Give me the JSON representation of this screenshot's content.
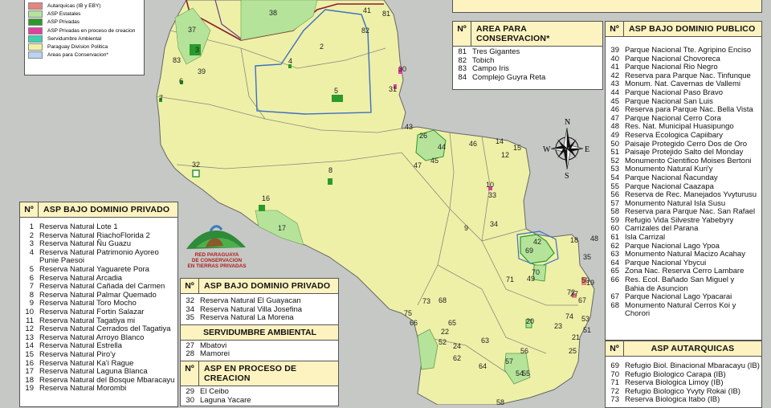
{
  "legend": [
    {
      "label": "Autarquicas (IB y EBY)",
      "color": "#e8837f"
    },
    {
      "label": "ASP Estatales",
      "color": "#b5e39a"
    },
    {
      "label": "ASP Privadas",
      "color": "#2a9a2a"
    },
    {
      "label": "ASP Privadas en proceso de creacion",
      "color": "#e040a0"
    },
    {
      "label": "Servidumbre Ambiental",
      "color": "#40d0b0"
    },
    {
      "label": "Paraguay Division Politica",
      "color": "#eef0a8"
    },
    {
      "label": "Areas para Conservacion*",
      "color": "#b8d4f0"
    }
  ],
  "map_labels": [
    "38",
    "41",
    "81",
    "82",
    "37",
    "2",
    "3",
    "83",
    "4",
    "39",
    "30",
    "6",
    "5",
    "31",
    "7",
    "43",
    "26",
    "44",
    "46",
    "14",
    "15",
    "45",
    "12",
    "47",
    "32",
    "8",
    "10",
    "33",
    "16",
    "9",
    "34",
    "17",
    "42",
    "18",
    "48",
    "69",
    "35",
    "70",
    "19",
    "71",
    "49",
    "50",
    "72",
    "73",
    "67",
    "75",
    "68",
    "66",
    "65",
    "27",
    "74",
    "20",
    "23",
    "53",
    "51",
    "21",
    "22",
    "52",
    "25",
    "63",
    "24",
    "62",
    "64",
    "57",
    "56",
    "55",
    "54",
    "58"
  ],
  "logo": {
    "line1": "RED PARAGUAYA",
    "line2": "DE CONSERVACION",
    "line3": "EN TIERRAS PRIVADAS"
  },
  "compass": {
    "n": "N",
    "s": "S",
    "e": "E",
    "w": "W"
  },
  "conservacion": {
    "num_header": "Nº",
    "title": "AREA PARA CONSERVACION*",
    "rows": [
      {
        "n": "81",
        "t": "Tres Gigantes"
      },
      {
        "n": "82",
        "t": "Tobich"
      },
      {
        "n": "83",
        "t": "Campo Iris"
      },
      {
        "n": "84",
        "t": "Complejo Guyra Reta"
      }
    ]
  },
  "publico": {
    "num_header": "Nº",
    "title": "ASP BAJO DOMINIO PUBLICO",
    "rows": [
      {
        "n": "39",
        "t": "Parque Nacional Tte. Agripino Enciso"
      },
      {
        "n": "40",
        "t": "Parque Nacional Chovoreca"
      },
      {
        "n": "41",
        "t": "Parque Nacional Rio Negro"
      },
      {
        "n": "42",
        "t": "Reserva para Parque Nac. Tinfunque"
      },
      {
        "n": "43",
        "t": "Monum. Nat. Cavernas de Vallemi"
      },
      {
        "n": "44",
        "t": "Parque Nacional Paso Bravo"
      },
      {
        "n": "45",
        "t": "Parque Nacional San Luis"
      },
      {
        "n": "46",
        "t": "Reserva para Parque Nac. Bella Vista"
      },
      {
        "n": "47",
        "t": "Parque Nacional Cerro Cora"
      },
      {
        "n": "48",
        "t": "Res. Nat. Municipal Huasipungo"
      },
      {
        "n": "49",
        "t": "Reserva Ecologica Capiibary"
      },
      {
        "n": "50",
        "t": "Paisaje Protegido Cerro Dos de Oro"
      },
      {
        "n": "51",
        "t": "Paisaje Protejido Salto del Monday"
      },
      {
        "n": "52",
        "t": "Monumento Cientifico Moises Bertoni"
      },
      {
        "n": "53",
        "t": "Monumento Natural Kuri'y"
      },
      {
        "n": "54",
        "t": "Parque Nacional Ñacunday"
      },
      {
        "n": "55",
        "t": "Parque Nacional Caazapa"
      },
      {
        "n": "56",
        "t": "Reserva de Rec. Manejados Yvyturusu"
      },
      {
        "n": "57",
        "t": "Monumento Natural Isla Susu"
      },
      {
        "n": "58",
        "t": "Reserva para Parque Nac. San Rafael"
      },
      {
        "n": "59",
        "t": "Refugio Vida Silvestre Yabebyry"
      },
      {
        "n": "60",
        "t": "Carrizales del Parana"
      },
      {
        "n": "61",
        "t": "Isla Carrizal"
      },
      {
        "n": "62",
        "t": "Parque Nacional Lago Ypoa"
      },
      {
        "n": "63",
        "t": "Monumento Natural Macizo Acahay"
      },
      {
        "n": "64",
        "t": "Parque Nacional Ybycui"
      },
      {
        "n": "65",
        "t": "Zona Nac. Reserva Cerro Lambare"
      },
      {
        "n": "66",
        "t": "Res. Ecol. Bañado San Miguel y"
      },
      {
        "n": "",
        "t": "Bahia de Asuncion"
      },
      {
        "n": "67",
        "t": "Parque Nacional Lago Ypacarai"
      },
      {
        "n": "68",
        "t": "Monumento Natural Cerros Koi y"
      },
      {
        "n": "",
        "t": "Chorori"
      }
    ]
  },
  "autarquicas": {
    "num_header": "Nº",
    "title": "ASP AUTARQUICAS",
    "rows": [
      {
        "n": "69",
        "t": "Refugio Biol. Binacional Mbaracayu (IB)"
      },
      {
        "n": "70",
        "t": "Refugio Biologico Carapa (IB)"
      },
      {
        "n": "71",
        "t": "Reserva Biologica Limoy (IB)"
      },
      {
        "n": "72",
        "t": "Refugio Biologico Yvyty Rokai (IB)"
      },
      {
        "n": "73",
        "t": "Reserva Biologica Itabo (IB)"
      }
    ]
  },
  "privado1": {
    "num_header": "Nº",
    "title": "ASP BAJO DOMINIO PRIVADO",
    "rows": [
      {
        "n": "1",
        "t": "Reserva Natural Lote 1"
      },
      {
        "n": "2",
        "t": "Reserva Natural RiachoFlorida 2"
      },
      {
        "n": "3",
        "t": "Reserva Natural Ñu Guazu"
      },
      {
        "n": "4",
        "t": "Reserva Natural Patrimonio Ayoreo"
      },
      {
        "n": "",
        "t": "Punie Paesoi"
      },
      {
        "n": "5",
        "t": "Reserva Natural Yaguarete Pora"
      },
      {
        "n": "6",
        "t": "Reserva Natural Arcadia"
      },
      {
        "n": "7",
        "t": "Reserva Natural Cañada del Carmen"
      },
      {
        "n": "8",
        "t": "Reserva Natural Palmar Quemado"
      },
      {
        "n": "9",
        "t": "Reserva Natural Toro Mocho"
      },
      {
        "n": "10",
        "t": "Reserva Natural Fortin Salazar"
      },
      {
        "n": "11",
        "t": "Reserva Natural Tagatiya mi"
      },
      {
        "n": "12",
        "t": "Reserva Natural Cerrados del Tagatiya"
      },
      {
        "n": "13",
        "t": "Reserva Natural Arroyo Blanco"
      },
      {
        "n": "14",
        "t": "Reserva Natural Estrella"
      },
      {
        "n": "15",
        "t": "Reserva Natural Piro'y"
      },
      {
        "n": "16",
        "t": "Reserva Natural Ka'i Rague"
      },
      {
        "n": "17",
        "t": "Reserva Natural Laguna Blanca"
      },
      {
        "n": "18",
        "t": "Reserva Natural del Bosque Mbaracayu"
      },
      {
        "n": "19",
        "t": "Reserva Natural Morombi"
      }
    ]
  },
  "privado2": {
    "num_header": "Nº",
    "title": "ASP BAJO DOMINIO PRIVADO",
    "rows": [
      {
        "n": "32",
        "t": "Reserva Natural El Guayacan"
      },
      {
        "n": "34",
        "t": "Reserva Natural Villa Josefina"
      },
      {
        "n": "35",
        "t": "Reserva Natural La Morena"
      }
    ]
  },
  "servidumbre": {
    "title": "SERVIDUMBRE AMBIENTAL",
    "rows": [
      {
        "n": "27",
        "t": "Mbatovi"
      },
      {
        "n": "28",
        "t": "Mamorei"
      }
    ]
  },
  "proceso": {
    "num_header": "Nº",
    "title": "ASP EN PROCESO DE CREACION",
    "rows": [
      {
        "n": "29",
        "t": "El Ceibo"
      },
      {
        "n": "30",
        "t": "Laguna Yacare"
      }
    ]
  }
}
